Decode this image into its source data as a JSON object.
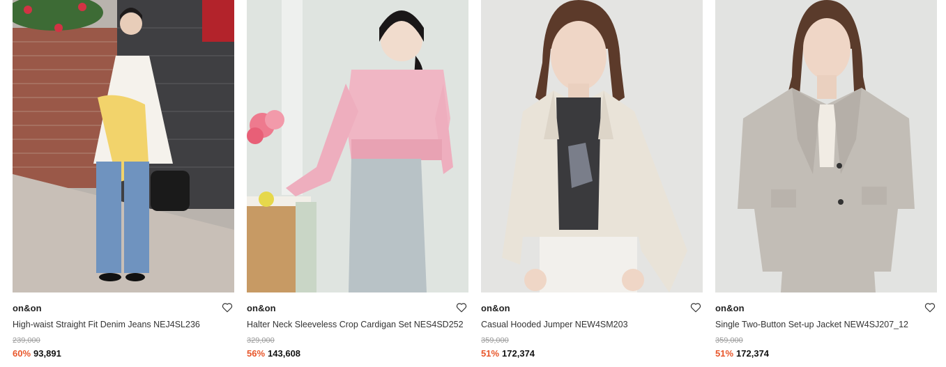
{
  "products": [
    {
      "brand": "on&on",
      "name": "High-waist Straight Fit Denim Jeans NEJ4SL236",
      "original_price": "239,000",
      "discount": "60%",
      "price": "93,891",
      "wishlist_icon": "heart-outline-icon"
    },
    {
      "brand": "on&on",
      "name": "Halter Neck Sleeveless Crop Cardigan Set NES4SD252",
      "original_price": "329,000",
      "discount": "56%",
      "price": "143,608",
      "wishlist_icon": "heart-outline-icon"
    },
    {
      "brand": "on&on",
      "name": "Casual Hooded Jumper NEW4SM203",
      "original_price": "359,000",
      "discount": "51%",
      "price": "172,374",
      "wishlist_icon": "heart-outline-icon"
    },
    {
      "brand": "on&on",
      "name": "Single Two-Button Set-up Jacket NEW4SJ207_12",
      "original_price": "359,000",
      "discount": "51%",
      "price": "172,374",
      "wishlist_icon": "heart-outline-icon"
    }
  ],
  "colors": {
    "discount": "#e8562a",
    "price": "#111111",
    "original_price": "#9a9a9a"
  }
}
